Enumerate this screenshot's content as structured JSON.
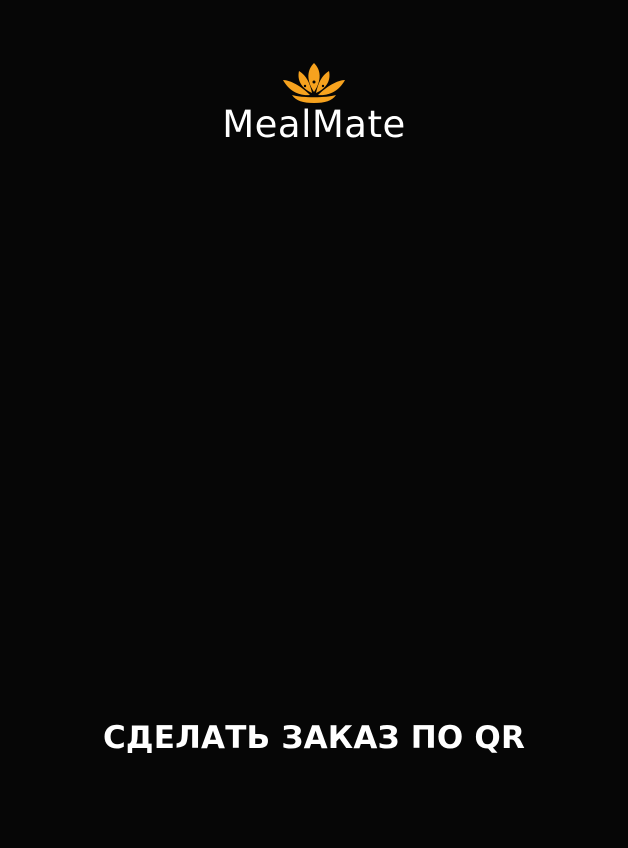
{
  "brand": {
    "name": "MealMate",
    "logo_icon": "lotus-icon",
    "logo_color": "#F6A21E"
  },
  "actions": {
    "order_qr_label": "СДЕЛАТЬ ЗАКАЗ ПО QR"
  },
  "theme": {
    "background": "#060606",
    "text": "#FFFFFF"
  }
}
